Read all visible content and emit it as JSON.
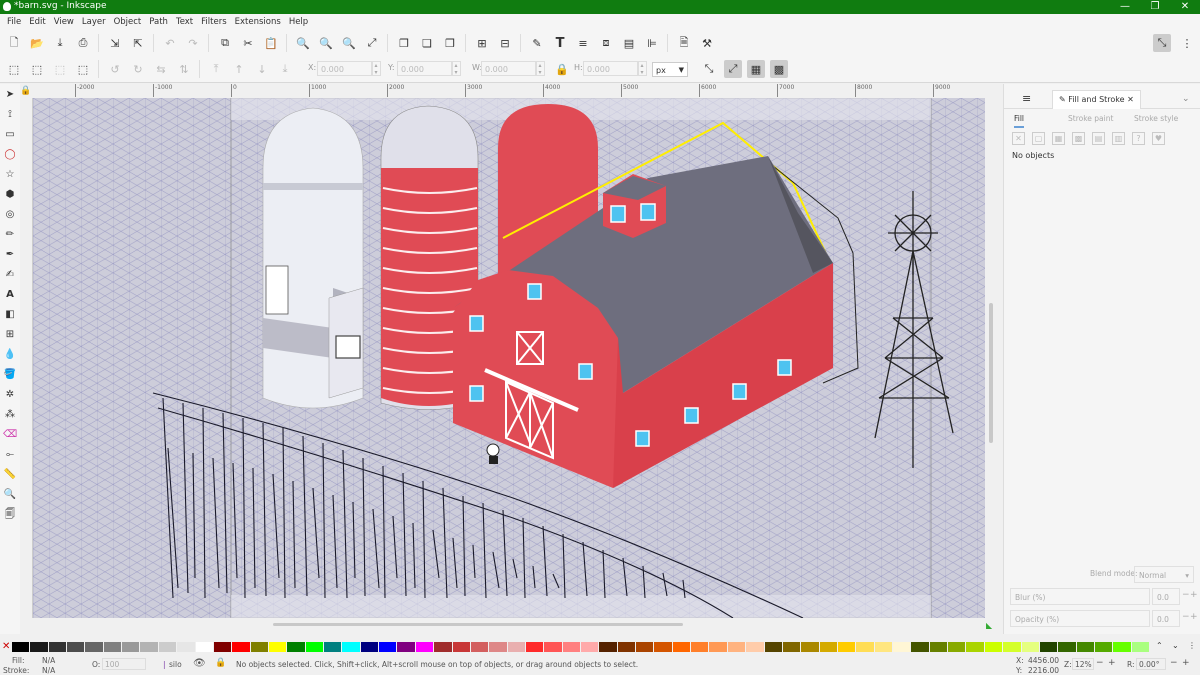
{
  "window": {
    "title": "*barn.svg - Inkscape",
    "minimize": "—",
    "maximize": "❐",
    "close": "✕"
  },
  "menu": [
    "File",
    "Edit",
    "View",
    "Layer",
    "Object",
    "Path",
    "Text",
    "Filters",
    "Extensions",
    "Help"
  ],
  "coords": {
    "x": {
      "label": "X:",
      "value": "0.000"
    },
    "y": {
      "label": "Y:",
      "value": "0.000"
    },
    "w": {
      "label": "W:",
      "value": "0.000"
    },
    "h": {
      "label": "H:",
      "value": "0.000"
    },
    "unit": "px"
  },
  "ruler_ticks": [
    "-2000",
    "-1000",
    "0",
    "1000",
    "2000",
    "3000",
    "4000",
    "5000",
    "6000",
    "7000",
    "8000",
    "9000"
  ],
  "dock": {
    "tab_label": "Fill and Stroke",
    "subtabs": [
      "Fill",
      "Stroke paint",
      "Stroke style"
    ],
    "fill_icons": [
      "✕",
      "▢",
      "▦",
      "▩",
      "▤",
      "▥",
      "?",
      "♥"
    ],
    "message": "No objects",
    "blend_label": "Blend mode:",
    "blend_value": "Normal",
    "blur_label": "Blur (%)",
    "blur_value": "0.0",
    "opacity_label": "Opacity (%)",
    "opacity_value": "0.0"
  },
  "palette_colors": [
    "#000000",
    "#1a1a1a",
    "#333333",
    "#4d4d4d",
    "#666666",
    "#808080",
    "#999999",
    "#b3b3b3",
    "#cccccc",
    "#e6e6e6",
    "#ffffff",
    "#800000",
    "#ff0000",
    "#808000",
    "#ffff00",
    "#008000",
    "#00ff00",
    "#008080",
    "#00ffff",
    "#000080",
    "#0000ff",
    "#800080",
    "#ff00ff",
    "#a02c2c",
    "#c83737",
    "#d35f5f",
    "#de8787",
    "#e9afaf",
    "#ff2a2a",
    "#ff5555",
    "#ff8080",
    "#ffaaaa",
    "#552200",
    "#803300",
    "#aa4400",
    "#d45500",
    "#ff6600",
    "#ff7f2a",
    "#ff9955",
    "#ffb380",
    "#ffccaa",
    "#554400",
    "#806600",
    "#aa8800",
    "#d4aa00",
    "#ffcc00",
    "#ffdd55",
    "#ffe680",
    "#fff6d5",
    "#445500",
    "#668000",
    "#88aa00",
    "#aad400",
    "#ccff00",
    "#d4ff2a",
    "#e5ff80",
    "#224400",
    "#336600",
    "#448800",
    "#55aa00",
    "#66ff00",
    "#aaff80"
  ],
  "status": {
    "fill_label": "Fill:",
    "fill_value": "N/A",
    "stroke_label": "Stroke:",
    "stroke_value": "N/A",
    "opacity_label": "O:",
    "opacity_value": "100",
    "layer": "silo",
    "message": "No objects selected. Click, Shift+click, Alt+scroll mouse on top of objects, or drag around objects to select.",
    "x_label": "X:",
    "x_value": "4456.00",
    "y_label": "Y:",
    "y_value": "2216.00",
    "zoom_label": "Z:",
    "zoom_value": "12%",
    "rotate_label": "R:",
    "rotate_value": "0.00°"
  }
}
